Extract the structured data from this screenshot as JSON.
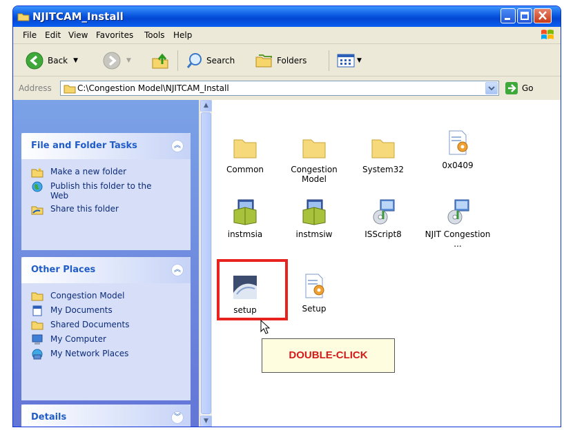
{
  "window": {
    "title": "NJITCAM_Install",
    "accent": "#0346d2"
  },
  "menu": [
    "File",
    "Edit",
    "View",
    "Favorites",
    "Tools",
    "Help"
  ],
  "toolbar": {
    "back_label": "Back",
    "search_label": "Search",
    "folders_label": "Folders"
  },
  "address": {
    "label": "Address",
    "value": "C:\\Congestion Model\\NJITCAM_Install",
    "go_label": "Go"
  },
  "sidebar": {
    "panels": [
      {
        "title": "File and Folder Tasks",
        "items": [
          {
            "label": "Make a new folder",
            "icon": "new-folder-icon"
          },
          {
            "label": "Publish this folder to the Web",
            "icon": "globe-icon"
          },
          {
            "label": "Share this folder",
            "icon": "share-icon"
          }
        ]
      },
      {
        "title": "Other Places",
        "items": [
          {
            "label": "Congestion Model",
            "icon": "folder-icon"
          },
          {
            "label": "My Documents",
            "icon": "documents-icon"
          },
          {
            "label": "Shared Documents",
            "icon": "folder-icon"
          },
          {
            "label": "My Computer",
            "icon": "computer-icon"
          },
          {
            "label": "My Network Places",
            "icon": "network-icon"
          }
        ]
      },
      {
        "title": "Details",
        "items": []
      }
    ]
  },
  "files": [
    {
      "name": "Common",
      "icon": "folder-icon"
    },
    {
      "name": "Congestion Model",
      "icon": "folder-icon"
    },
    {
      "name": "System32",
      "icon": "folder-icon"
    },
    {
      "name": "0x0409",
      "icon": "settings-file-icon"
    },
    {
      "name": "instmsia",
      "icon": "installer-icon"
    },
    {
      "name": "instmsiw",
      "icon": "installer-icon"
    },
    {
      "name": "ISScript8",
      "icon": "setup-package-icon"
    },
    {
      "name": "NJIT Congestion ...",
      "icon": "setup-package-icon"
    },
    {
      "name": "setup",
      "icon": "setup-app-icon"
    },
    {
      "name": "Setup",
      "icon": "settings-file-icon"
    }
  ],
  "annotation": {
    "callout_text": "DOUBLE-CLICK",
    "highlight_color": "#e8231f"
  }
}
